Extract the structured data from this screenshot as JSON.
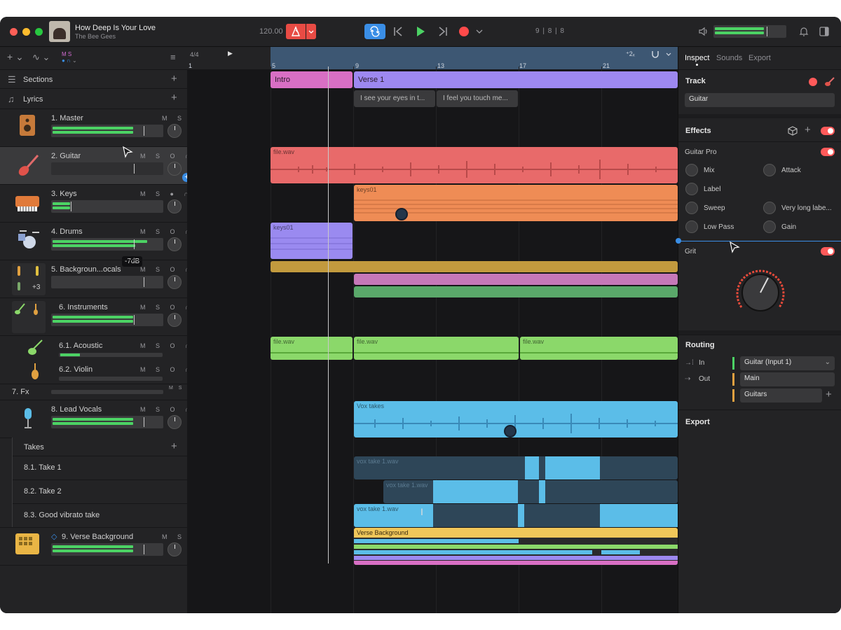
{
  "song": {
    "title": "How Deep Is Your Love",
    "artist": "The Bee Gees"
  },
  "transport": {
    "tempo": "120.00",
    "position": "9 | 8 | 8"
  },
  "ruler": {
    "time_signature": "4/4",
    "bars": [
      "1",
      "5",
      "9",
      "13",
      "17",
      "21"
    ],
    "zoom": "⁺2ₓ"
  },
  "global_tracks": {
    "sections_label": "Sections",
    "lyrics_label": "Lyrics"
  },
  "sections": [
    {
      "label": "Intro",
      "color": "#d86fc4"
    },
    {
      "label": "Verse 1",
      "color": "#9d88f0"
    }
  ],
  "lyrics": [
    "I see your eyes in t...",
    "I feel you touch me..."
  ],
  "tracks": [
    {
      "name": "1. Master",
      "ms": "M S"
    },
    {
      "name": "2. Guitar",
      "ms": "M S O ∩"
    },
    {
      "name": "3. Keys",
      "ms": "M S ● ∩"
    },
    {
      "name": "4. Drums",
      "ms": "M S O ∩"
    },
    {
      "name": "5. Backgroun...ocals",
      "ms": "M S O ∩"
    },
    {
      "name": "6. Instruments",
      "ms": "M S O ∩"
    },
    {
      "name": "6.1. Acoustic",
      "ms": "M S O ∩"
    },
    {
      "name": "6.2. Violin",
      "ms": "M S O ∩"
    },
    {
      "name": "7. Fx",
      "ms": "M S"
    },
    {
      "name": "8. Lead Vocals",
      "ms": "M S O ∩"
    },
    {
      "name": "9. Verse Background",
      "ms": "M S"
    }
  ],
  "plus_count": "+3",
  "volume_tooltip": "-7dB",
  "takes": {
    "label": "Takes",
    "items": [
      "8.1. Take 1",
      "8.2. Take 2",
      "8.3. Good vibrato take"
    ]
  },
  "clips": {
    "guitar": "file.wav",
    "keys": "keys01",
    "drums": "keys01",
    "acoustic_1": "file.wav",
    "acoustic_2": "file.wav",
    "acoustic_3": "file.wav",
    "vox": "Vox takes",
    "take1": "vox take 1.wav",
    "take2": "vox take 1.wav",
    "take3": "vox take 1.wav",
    "verse_bg": "Verse Background"
  },
  "inspector": {
    "tabs": [
      "Inspect",
      "Sounds",
      "Export"
    ],
    "track_heading": "Track",
    "track_name": "Guitar",
    "effects_heading": "Effects",
    "effect1_name": "Guitar Pro",
    "effect1_params": [
      "Mix",
      "Attack",
      "Label",
      "Sweep",
      "Very long labe...",
      "Low Pass",
      "Gain"
    ],
    "effect2_name": "Grit",
    "routing_heading": "Routing",
    "in_label": "In",
    "out_label": "Out",
    "in_value": "Guitar (Input 1)",
    "out_value": "Main",
    "out_value2": "Guitars",
    "export_heading": "Export"
  },
  "colors": {
    "accent_blue": "#3a8ee6",
    "record_red": "#ff5a5a",
    "meter_green": "#4cd264",
    "guitar_clip": "#e86a6a",
    "keys_clip": "#ef8c55",
    "drums_clip": "#9a8af0",
    "vocals_clip": "#5bbde8",
    "acoustic_clip": "#8bd86a",
    "verse_bg_clip": "#f0c75a"
  }
}
